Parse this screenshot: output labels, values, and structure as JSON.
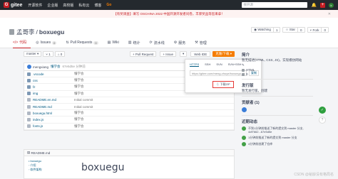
{
  "nav": {
    "logo_letter": "G",
    "logo_text": "gitee",
    "links": [
      "开源软件",
      "企业版",
      "高校版",
      "私有云",
      "博客",
      "Go"
    ],
    "search_placeholder": "搜开源",
    "avatar_letter": "k",
    "plus": "+"
  },
  "announce": {
    "text": "【有奖调查】填写 OSCHINA 2022 中国开源开发者问卷，丰厚奖品等您来拿！",
    "close": "✕"
  },
  "repo": {
    "owner": "孟哥李",
    "sep": "/",
    "name": "boxuegu",
    "watch_label": "◉ Watching",
    "watch_count": "1",
    "star_label": "☆ Star",
    "star_count": "0",
    "fork_label": "⑂ Fork",
    "fork_count": "0"
  },
  "tabs": [
    {
      "label": "代码",
      "badge": ""
    },
    {
      "label": "Issues",
      "badge": "0"
    },
    {
      "label": "Pull Requests",
      "badge": "0"
    },
    {
      "label": "Wiki",
      "badge": ""
    },
    {
      "label": "统计",
      "badge": ""
    },
    {
      "label": "流水线",
      "badge": ""
    },
    {
      "label": "服务",
      "badge": ""
    },
    {
      "label": "管理",
      "badge": ""
    }
  ],
  "toolbar": {
    "branch": "master ▾",
    "branch_count": "1",
    "tag_count": "0",
    "pr_button": "+ Pull Request",
    "issue_button": "+ Issue",
    "webide": "Web IDE",
    "clone": "克隆/下载 ▾"
  },
  "commit": {
    "user": "mengxiang",
    "message": "懂学会",
    "sha": "67e5d5e 分钟前"
  },
  "files": [
    {
      "name": ".vscode",
      "msg": "懂学会",
      "type": "dir"
    },
    {
      "name": "css",
      "msg": "懂学会",
      "type": "dir"
    },
    {
      "name": "fz",
      "msg": "懂学会",
      "type": "dir"
    },
    {
      "name": "img",
      "msg": "懂学会",
      "type": "dir"
    },
    {
      "name": "README.en.md",
      "msg": "Initial commit",
      "type": "file"
    },
    {
      "name": "README.md",
      "msg": "Initial commit",
      "type": "file"
    },
    {
      "name": "boxuegu.html",
      "msg": "懂学会",
      "type": "file"
    },
    {
      "name": "index.js",
      "msg": "懂学会",
      "type": "file"
    },
    {
      "name": "fonts.js",
      "msg": "懂学会",
      "type": "file"
    }
  ],
  "readme": {
    "label": "README.md",
    "toc": [
      "• boxuegu",
      "  ◦ 介绍",
      "  ◦ 软件架构"
    ],
    "title": "boxuegu"
  },
  "dropdown": {
    "tabs": [
      "HTTPS",
      "SSH",
      "SVN",
      "SVN+SSH"
    ],
    "url": "https://gitee.com/meng-zhuye/boxuegu.git",
    "copy": "复制",
    "zip": "⇩ 下载ZIP"
  },
  "side": {
    "intro_title": "简介",
    "intro_text": "暂无描述(HTML, CSS, JS)，实现模仿网站",
    "row1": "✎",
    "lang": "HTML",
    "row2": "0",
    "release_title": "发行版",
    "release_text": "暂无发行版，创建",
    "contrib_title": "贡献者",
    "contrib_count": "(1)",
    "activity_title": "近期动态",
    "activities": [
      {
        "text": "不到1分钟前推送了新的提交到 master 分支, 4df7662...67e5d5e",
        "link": ""
      },
      {
        "text": "1分钟前推送了新的提交到 master 分支",
        "link": ""
      },
      {
        "text": "4分钟前创建了仓库",
        "link": ""
      }
    ]
  },
  "floats": [
    "✓",
    "?"
  ],
  "watermark": "CSDN @秘龄没有格局名"
}
